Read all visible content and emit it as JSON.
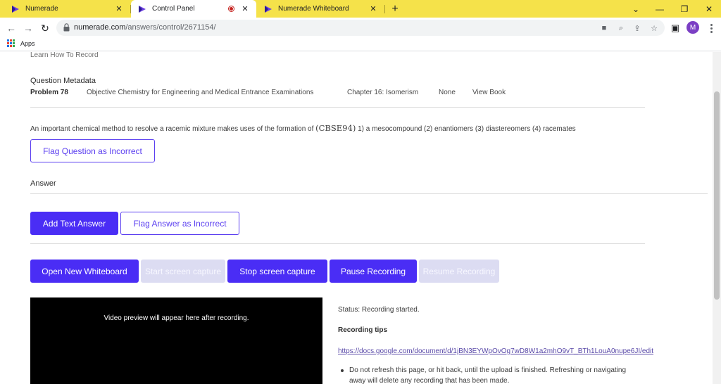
{
  "browser": {
    "tabs": [
      {
        "title": "Numerade",
        "active": false
      },
      {
        "title": "Control Panel",
        "active": true,
        "recording": true
      },
      {
        "title": "Numerade Whiteboard",
        "active": false
      }
    ],
    "url_host": "numerade.com",
    "url_path": "/answers/control/2671154/",
    "profile_initial": "M",
    "bookmarks": {
      "apps_label": "Apps"
    },
    "accent_color": "#f5e24a"
  },
  "page": {
    "cutoff_text": "Learn How To Record",
    "metadata": {
      "heading": "Question Metadata",
      "problem": "Problem 78",
      "book": "Objective Chemistry for Engineering and Medical Entrance Examinations",
      "chapter": "Chapter 16: Isomerism",
      "section": "None",
      "view_book": "View Book"
    },
    "question": {
      "text_before": "An important chemical method to resolve a racemic mixture makes uses of the formation of ",
      "math": "(CBSE94)",
      "text_after": " 1) a mesocompound (2) enantiomers (3) diastereomers (4) racemates"
    },
    "flag_question_label": "Flag Question as Incorrect",
    "answer_heading": "Answer",
    "add_text_answer_label": "Add Text Answer",
    "flag_answer_label": "Flag Answer as Incorrect",
    "recording_controls": {
      "open_whiteboard": "Open New Whiteboard",
      "start_capture": "Start screen capture",
      "stop_capture": "Stop screen capture",
      "pause_recording": "Pause Recording",
      "resume_recording": "Resume Recording"
    },
    "video_preview_text": "Video preview will appear here after recording.",
    "status_text": "Status: Recording started.",
    "tips_heading": "Recording tips",
    "tips_link": "https://docs.google.com/document/d/1jBN3EYWpOvOg7wD8W1a2mhO9vT_BTh1LouA0nupe6JI/edit",
    "tips": [
      "Do not refresh this page, or hit back, until the upload is finished. Refreshing or navigating away will delete any recording that has been made."
    ],
    "colors": {
      "primary": "#4a2df5",
      "disabled": "#dcdcf2"
    }
  }
}
